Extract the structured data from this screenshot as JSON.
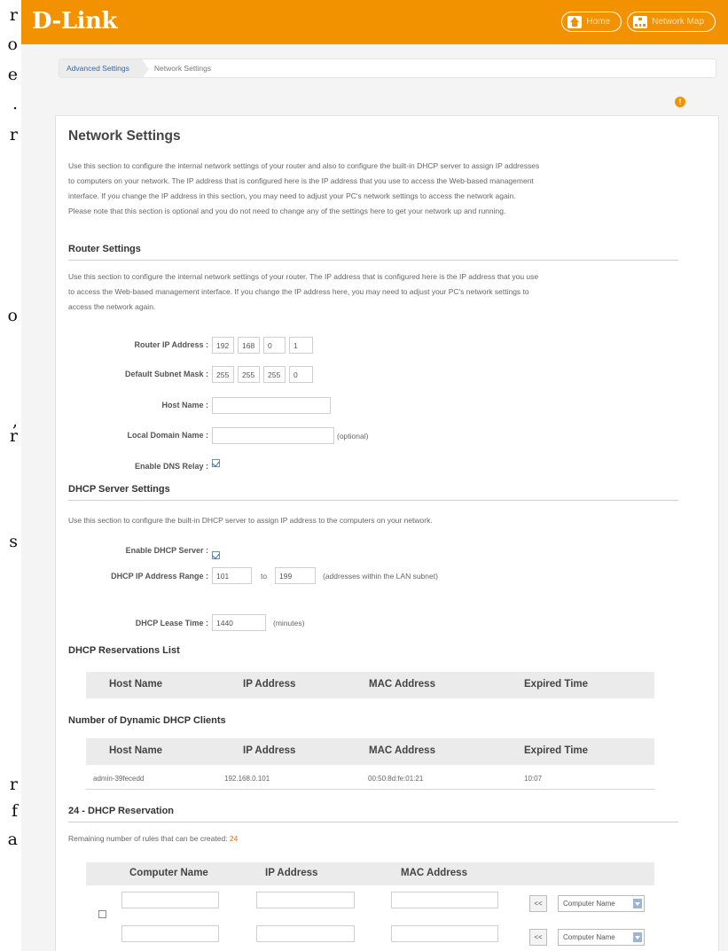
{
  "left_column": [
    "r",
    "o",
    "e",
    ".",
    "r",
    "o",
    ",",
    "r",
    "s",
    "r",
    "f",
    "a"
  ],
  "header": {
    "logo": "D-Link",
    "nav": {
      "home": "Home",
      "network_map": "Network Map"
    }
  },
  "breadcrumb": {
    "parent": "Advanced Settings",
    "current": "Network Settings"
  },
  "page": {
    "title": "Network Settings",
    "intro": [
      "Use this section to configure the internal network settings of your router and also to configure the built-in DHCP server to assign IP addresses",
      "to computers on your network. The IP address that is configured here is the IP address that you use to access the Web-based management",
      "interface. If you change the IP address in this section, you may need to adjust your PC's network settings to access the network again.",
      "Please note that this section is optional and you do not need to change any of the settings here to get your network up and running."
    ]
  },
  "router": {
    "title": "Router Settings",
    "desc": [
      "Use this section to configure the internal network settings of your router. The IP address that is configured here is the IP address that you use",
      "to access the Web-based management interface. If you change the IP address here, you may need to adjust your PC's network settings to",
      "access the network again."
    ],
    "ip_label": "Router IP Address :",
    "ip": [
      "192",
      "168",
      "0",
      "1"
    ],
    "mask_label": "Default Subnet Mask :",
    "mask": [
      "255",
      "255",
      "255",
      "0"
    ],
    "host_label": "Host Name :",
    "host_value": "",
    "domain_label": "Local Domain Name :",
    "domain_value": "",
    "optional": "(optional)",
    "dns_label": "Enable DNS Relay :"
  },
  "dhcp": {
    "title": "DHCP Server Settings",
    "desc": "Use this section to configure the built-in DHCP server to assign IP address to the computers on your network.",
    "enable_label": "Enable DHCP Server :",
    "range_label": "DHCP IP Address Range :",
    "range_start": "101",
    "to": "to",
    "range_end": "199",
    "range_note": "(addresses within the LAN subnet)",
    "lease_label": "DHCP Lease Time :",
    "lease_value": "1440",
    "lease_unit": "(minutes)"
  },
  "reservations_list": {
    "title": "DHCP Reservations List",
    "columns": [
      "Host Name",
      "IP Address",
      "MAC Address",
      "Expired Time"
    ]
  },
  "dynamic_clients": {
    "title": "Number of Dynamic DHCP Clients",
    "columns": [
      "Host Name",
      "IP Address",
      "MAC Address",
      "Expired Time"
    ],
    "rows": [
      {
        "host": "admin-39fecedd",
        "ip": "192.168.0.101",
        "mac": "00:50:8d:fe:01:21",
        "expired": "10:07"
      }
    ]
  },
  "reservation": {
    "title": "24 - DHCP Reservation",
    "remaining": "Remaining number of rules that can be created: ",
    "remaining_count": "24",
    "columns": [
      "Computer Name",
      "IP Address",
      "MAC Address"
    ],
    "copy_btn": "<<",
    "select_value": "Computer Name"
  },
  "colors": {
    "brand": "#f39200",
    "link": "#3565a8",
    "remaining_count": "#e07000"
  }
}
